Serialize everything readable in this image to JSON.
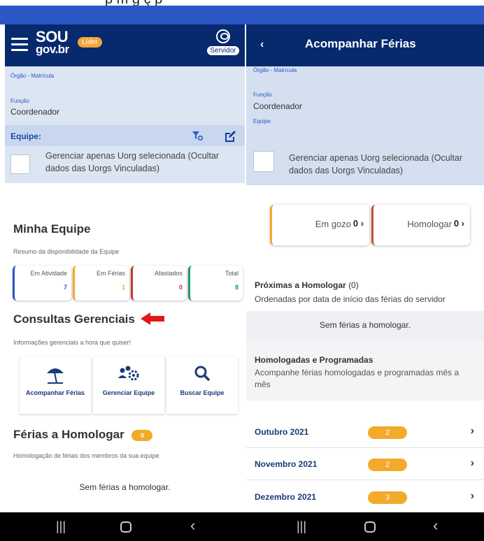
{
  "caption_partial": "p    m      g ç      p",
  "left": {
    "brand": {
      "sou": "SOU",
      "gov": "gov.br",
      "badge": "Líder"
    },
    "profile_label": "Servidor",
    "orgao_label": "Órgão - Matrícula",
    "funcao_label": "Função",
    "funcao_value": "Coordenador",
    "equipe_label": "Equipe:",
    "manage_text": "Gerenciar apenas Uorg selecionada (Ocultar dados das Uorgs Vinculadas)",
    "minha_equipe": {
      "title": "Minha Equipe",
      "subtitle": "Resumo da disponibilidade da Equipe",
      "stats": [
        {
          "label": "Em Atividade",
          "value": "7",
          "color": "#2a57c4"
        },
        {
          "label": "Em Férias",
          "value": "1",
          "color": "#f2aa2b"
        },
        {
          "label": "Afastados",
          "value": "0",
          "color": "#c0392b"
        },
        {
          "label": "Total",
          "value": "8",
          "color": "#1a9a6a"
        }
      ]
    },
    "consultas": {
      "title": "Consultas Gerenciais",
      "subtitle": "Informações gerenciais a hora que quiser!",
      "tiles": [
        {
          "label": "Acompanhar Férias",
          "icon": "beach-umbrella-icon"
        },
        {
          "label": "Gerenciar Equipe",
          "icon": "team-gear-icon"
        },
        {
          "label": "Buscar Equipe",
          "icon": "search-icon"
        }
      ]
    },
    "ferias": {
      "title": "Férias a Homologar",
      "count": "0",
      "subtitle": "Homologação de férias dos membros da sua equipe",
      "empty": "Sem férias a homologar."
    }
  },
  "right": {
    "title": "Acompanhar Férias",
    "back_icon": "chevron-left-icon",
    "orgao_label": "Órgão - Matrícula",
    "funcao_label": "Função",
    "funcao_value": "Coordenador",
    "equipe_label": "Equipe",
    "manage_text": "Gerenciar apenas Uorg selecionada (Ocultar dados das Uorgs Vinculadas)",
    "cards": [
      {
        "label": "Em gozo",
        "value": "0",
        "color": "#f2aa2b"
      },
      {
        "label": "Homologar",
        "value": "0",
        "color": "#c0562b"
      }
    ],
    "proximas": {
      "title": "Próximas a Homologar",
      "count": "(0)",
      "subtitle": "Ordenadas por data de início das férias do servidor",
      "empty": "Sem férias a homologar."
    },
    "homologadas": {
      "title": "Homologadas e Programadas",
      "subtitle": "Acompanhe férias homologadas e programadas mês a mês"
    },
    "months": [
      {
        "name": "Outubro 2021",
        "count": "2"
      },
      {
        "name": "Novembro 2021",
        "count": "2"
      },
      {
        "name": "Dezembro 2021",
        "count": "3"
      }
    ]
  },
  "colors": {
    "header": "#07296e",
    "accent": "#f2aa2b",
    "statusbar": "#2a57c4",
    "pointer_arrow": "#e3161a"
  }
}
